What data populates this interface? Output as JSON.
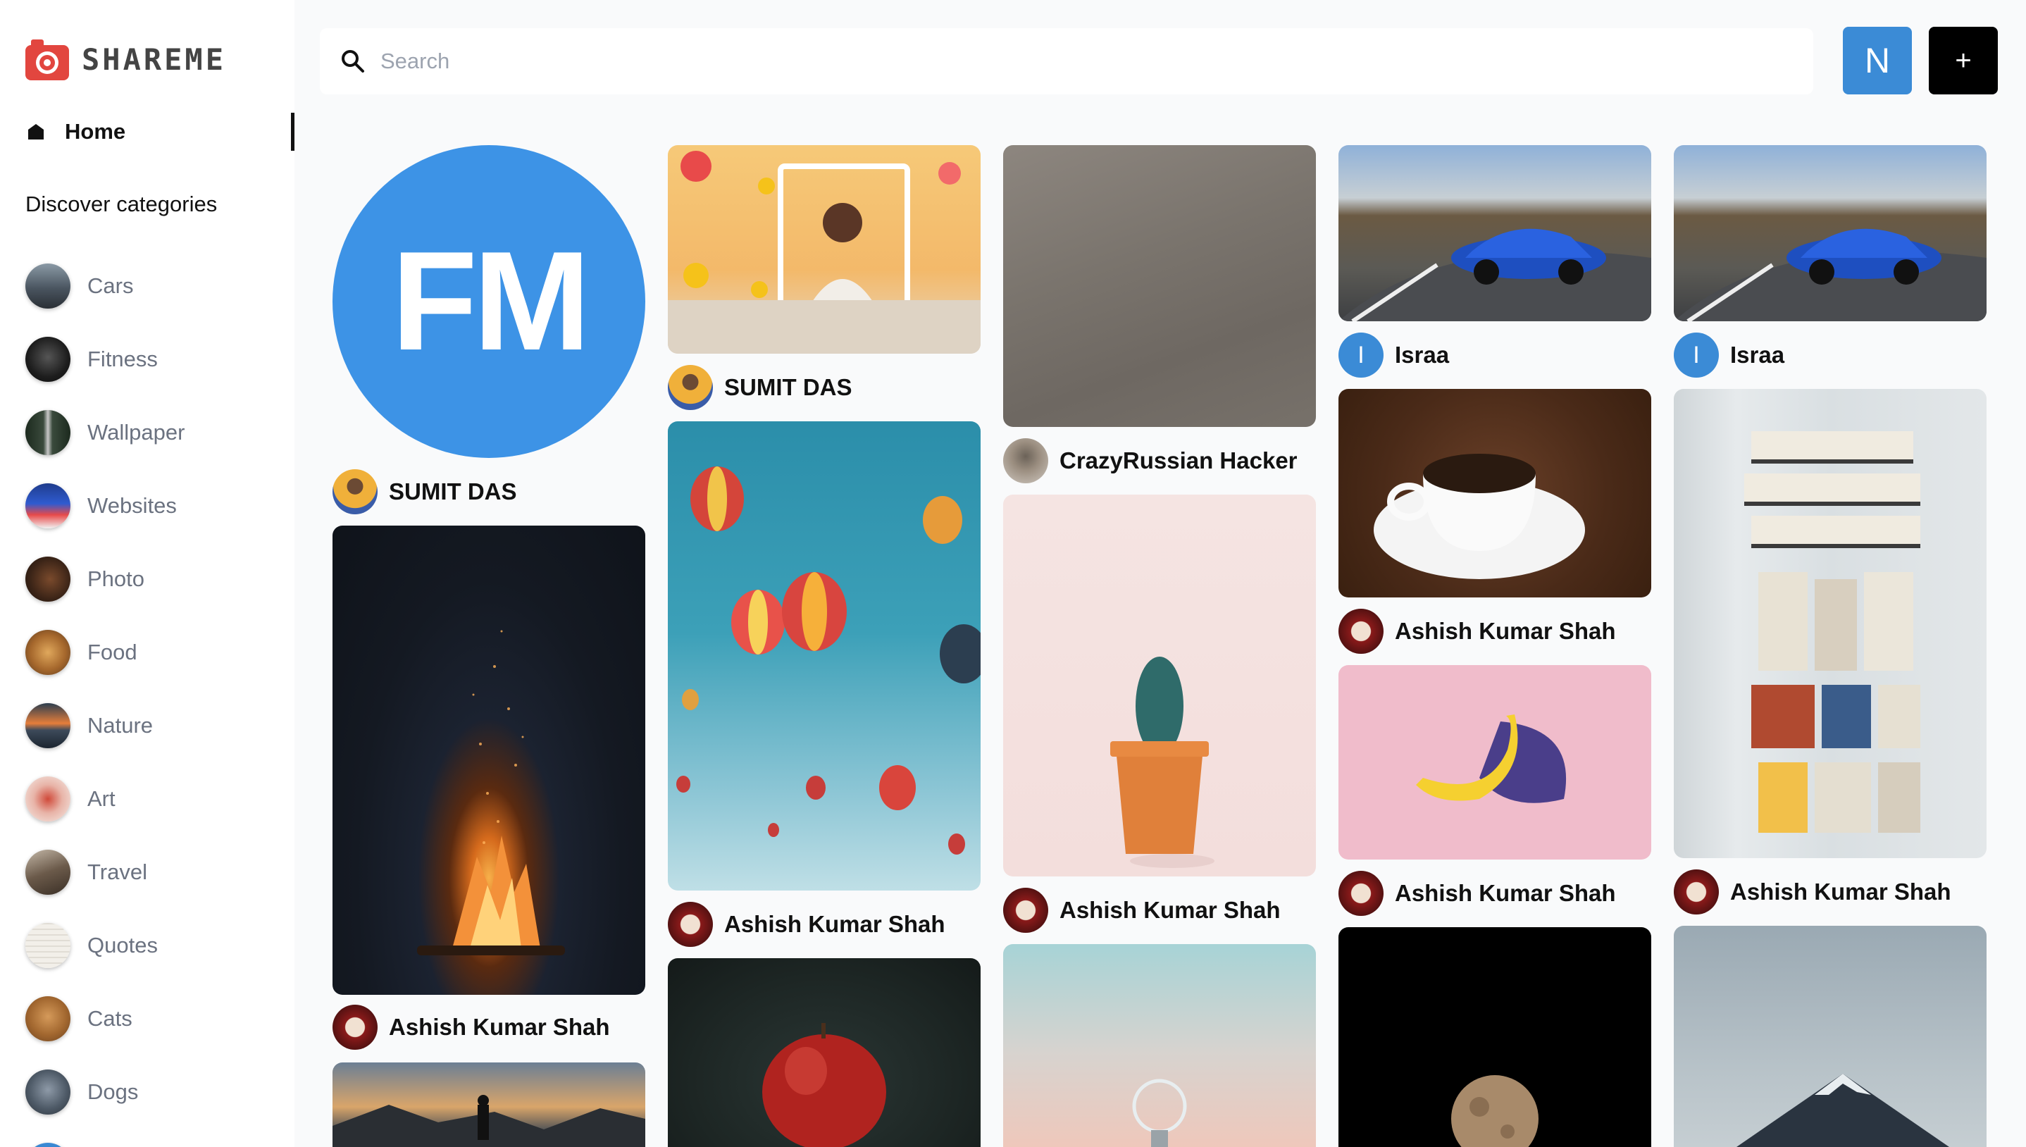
{
  "app": {
    "name": "SHAREME"
  },
  "colors": {
    "brand": "#e2463f",
    "accent": "#3b8bd6",
    "text": "#111111",
    "muted": "#6b7280"
  },
  "sidebar": {
    "home_label": "Home",
    "discover_label": "Discover categories",
    "categories": [
      {
        "label": "Cars"
      },
      {
        "label": "Fitness"
      },
      {
        "label": "Wallpaper"
      },
      {
        "label": "Websites"
      },
      {
        "label": "Photo"
      },
      {
        "label": "Food"
      },
      {
        "label": "Nature"
      },
      {
        "label": "Art"
      },
      {
        "label": "Travel"
      },
      {
        "label": "Quotes"
      },
      {
        "label": "Cats"
      },
      {
        "label": "Dogs"
      }
    ]
  },
  "header": {
    "search_placeholder": "Search",
    "user_initial": "N",
    "add_label": "+"
  },
  "feed": {
    "logo_pin_text": "FM",
    "pins": [
      {
        "user": "SUMIT DAS",
        "image": "fm-logo"
      },
      {
        "user": "Ashish Kumar Shah",
        "image": "bonfire"
      },
      {
        "user": "SUMIT DAS",
        "image": "influencer-frame"
      },
      {
        "user": "Ashish Kumar Shah",
        "image": "hot-air-balloons"
      },
      {
        "user": "",
        "image": "red-apple"
      },
      {
        "user": "CrazyRussian Hacker",
        "image": "grey-texture"
      },
      {
        "user": "Ashish Kumar Shah",
        "image": "cactus-pot"
      },
      {
        "user": "",
        "image": "light-bulb"
      },
      {
        "user": "Israa",
        "user_initial": "I",
        "image": "blue-car"
      },
      {
        "user": "Ashish Kumar Shah",
        "image": "coffee-cup"
      },
      {
        "user": "Ashish Kumar Shah",
        "image": "banana"
      },
      {
        "user": "",
        "image": "moon"
      },
      {
        "user": "Israa",
        "user_initial": "I",
        "image": "blue-car"
      },
      {
        "user": "Ashish Kumar Shah",
        "image": "bookshelf"
      },
      {
        "user": "",
        "image": "mountain"
      },
      {
        "user": "",
        "image": "sunset-person"
      }
    ]
  }
}
